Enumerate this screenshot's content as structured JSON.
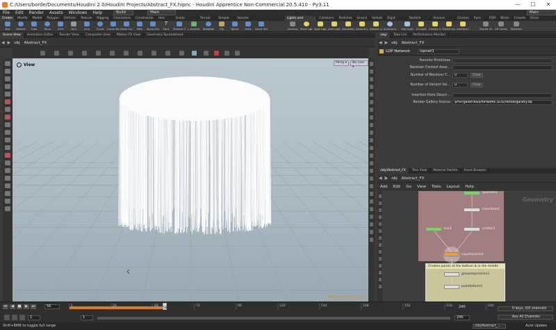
{
  "window": {
    "title": "C:/Users/borde/Documents/Houdini 2.0/Houdini Projects/Abstract_FX.hipnc - Houdini Apprentice Non-Commercial 20.5.410 - Py3.11",
    "controls": [
      "—",
      "☐",
      "✕"
    ]
  },
  "menu": {
    "items": [
      "File",
      "Edit",
      "Render",
      "Assets",
      "Windows",
      "Help"
    ],
    "desktop1": "Build",
    "desktop2": "Main",
    "desktop3": "Main"
  },
  "shelf": {
    "tabs_left": [
      "Create",
      "Modify",
      "Model",
      "Polygon",
      "Deform",
      "Texture",
      "Rigging",
      "Characters",
      "Constraints",
      "Hair Utils",
      "Guide Process",
      "Terrain FX",
      "Simple FX",
      "Volume"
    ],
    "tabs_right": [
      "Lights and Cameras",
      "Collisions",
      "Particles",
      "Grains",
      "Vellum",
      "Rigid Bodies",
      "Particle Fluids",
      "Viscous Fluids",
      "Oceans",
      "Pyro FX",
      "FEM",
      "Wires",
      "Crowds",
      "Drive Simulation"
    ],
    "tools_left": [
      "Box",
      "Sphere",
      "Tube",
      "Torus",
      "Grid",
      "Null",
      "Line",
      "Circle",
      "Curve Bezier",
      "Draw Curve",
      "Path",
      "Spray Paint",
      "Font",
      "Platonic Solids",
      "L-System",
      "Metaball",
      "File",
      "Spiral",
      "Helix",
      "Quick Shapes"
    ],
    "tools_right": [
      "Camera",
      "Point Light",
      "Spot Light",
      "Area Light",
      "Geometry Light",
      "Volume Light",
      "Distant Light",
      "Environment Light",
      "Sky Light",
      "GI Light",
      "Caustic Light",
      "Portal Light",
      "Ambient Light",
      "Stereo Camera",
      "VR Camera",
      "Switcher"
    ]
  },
  "viewer": {
    "tabs": [
      "Scene View",
      "Animation Editor",
      "Render View",
      "Composite View",
      "Motion FX View",
      "Geometry Spreadsheet"
    ],
    "path": "obj",
    "node": "Abstract_FX",
    "label": "View",
    "persp": "Persp ▾",
    "cam": "No cam ▾",
    "hint": "Non-Commercial Edition"
  },
  "right_top": {
    "tabs": [
      "/obj/",
      "Take List",
      "Performance Monitor"
    ],
    "path": "obj",
    "node": "Abstract_FX"
  },
  "params": {
    "header_type": "LOP Network",
    "header_name": "lopnet1",
    "rows": [
      {
        "label": "Favorite Primitives",
        "value": ""
      },
      {
        "label": "Receiver Context Asse...",
        "value": ""
      },
      {
        "label": "Number of Receiver C...",
        "value": "0",
        "button": "Clear"
      },
      {
        "label": "Number of Variant Sel...",
        "value": "0",
        "button": "Clear"
      },
      {
        "label": "Insertion Point Descri...",
        "value": ""
      },
      {
        "label": "Render Gallery Source",
        "value": "$HIP/galleries/$HIPNAME.$OS/rendergallery.db"
      }
    ]
  },
  "network": {
    "tabs": [
      "/obj/Abstract_FX",
      "Tree View",
      "Material Palette",
      "Asset Browser"
    ],
    "path": "obj",
    "node": "Abstract_FX",
    "menu": [
      "Add",
      "Edit",
      "Go",
      "View",
      "Tools",
      "Layout",
      "Help"
    ],
    "context": "Geometry",
    "nodes": [
      {
        "name": "geometry",
        "top": "true"
      },
      {
        "name": "transform1"
      },
      {
        "name": "line1"
      },
      {
        "name": "scatter1"
      },
      {
        "name": "copytopoints1"
      },
      {
        "name": "groupexpression1"
      },
      {
        "name": "pointdeform1"
      }
    ],
    "note": "Creates points at the bottom & in the middle"
  },
  "timeline": {
    "frame": "56",
    "start": "1",
    "start2": "1",
    "end": "240",
    "end2": "240",
    "ticks": [
      "1",
      "24",
      "48",
      "72",
      "96",
      "120",
      "144",
      "168",
      "192",
      "216",
      "240"
    ],
    "current_marker": "56",
    "keys": "0 keys, 0/0 channels",
    "key_all": "Key All Channels",
    "auto": "Auto Update"
  },
  "status": {
    "text": "Shift+RMB to toggle full range",
    "path": "/obj/Abstract_..."
  }
}
